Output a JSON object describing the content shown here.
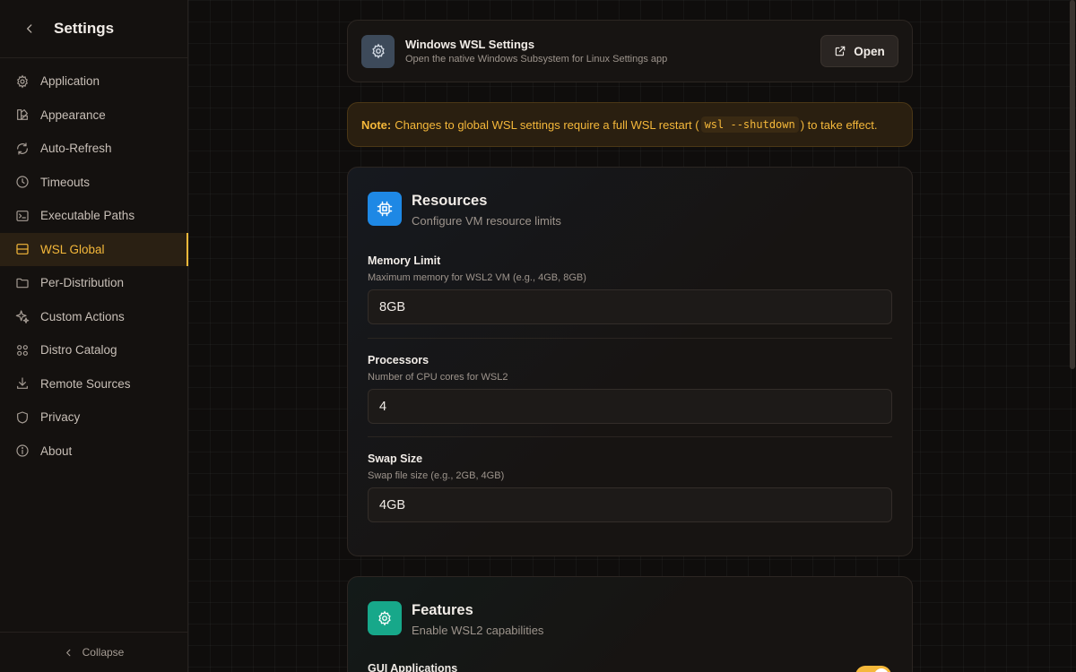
{
  "sidebar": {
    "title": "Settings",
    "items": [
      {
        "label": "Application",
        "icon": "gear-icon"
      },
      {
        "label": "Appearance",
        "icon": "palette-icon"
      },
      {
        "label": "Auto-Refresh",
        "icon": "refresh-icon"
      },
      {
        "label": "Timeouts",
        "icon": "clock-icon"
      },
      {
        "label": "Executable Paths",
        "icon": "terminal-icon"
      },
      {
        "label": "WSL Global",
        "icon": "server-icon",
        "active": true
      },
      {
        "label": "Per-Distribution",
        "icon": "folder-icon"
      },
      {
        "label": "Custom Actions",
        "icon": "sparkles-icon"
      },
      {
        "label": "Distro Catalog",
        "icon": "grid-icon"
      },
      {
        "label": "Remote Sources",
        "icon": "download-icon"
      },
      {
        "label": "Privacy",
        "icon": "shield-icon"
      },
      {
        "label": "About",
        "icon": "info-icon"
      }
    ],
    "collapse_label": "Collapse"
  },
  "wsl_settings": {
    "title": "Windows WSL Settings",
    "subtitle": "Open the native Windows Subsystem for Linux Settings app",
    "open_label": "Open"
  },
  "note": {
    "prefix": "Note:",
    "text_before": "Changes to global WSL settings require a full WSL restart (",
    "code": "wsl --shutdown",
    "text_after": ") to take effect."
  },
  "resources": {
    "title": "Resources",
    "subtitle": "Configure VM resource limits",
    "fields": [
      {
        "label": "Memory Limit",
        "hint": "Maximum memory for WSL2 VM (e.g., 4GB, 8GB)",
        "value": "8GB"
      },
      {
        "label": "Processors",
        "hint": "Number of CPU cores for WSL2",
        "value": "4"
      },
      {
        "label": "Swap Size",
        "hint": "Swap file size (e.g., 2GB, 4GB)",
        "value": "4GB"
      }
    ]
  },
  "features": {
    "title": "Features",
    "subtitle": "Enable WSL2 capabilities",
    "gui_label": "GUI Applications",
    "gui_enabled": true
  },
  "colors": {
    "accent": "#f5b83a",
    "resources_icon": "#1e88e5",
    "features_icon": "#17a88a"
  }
}
